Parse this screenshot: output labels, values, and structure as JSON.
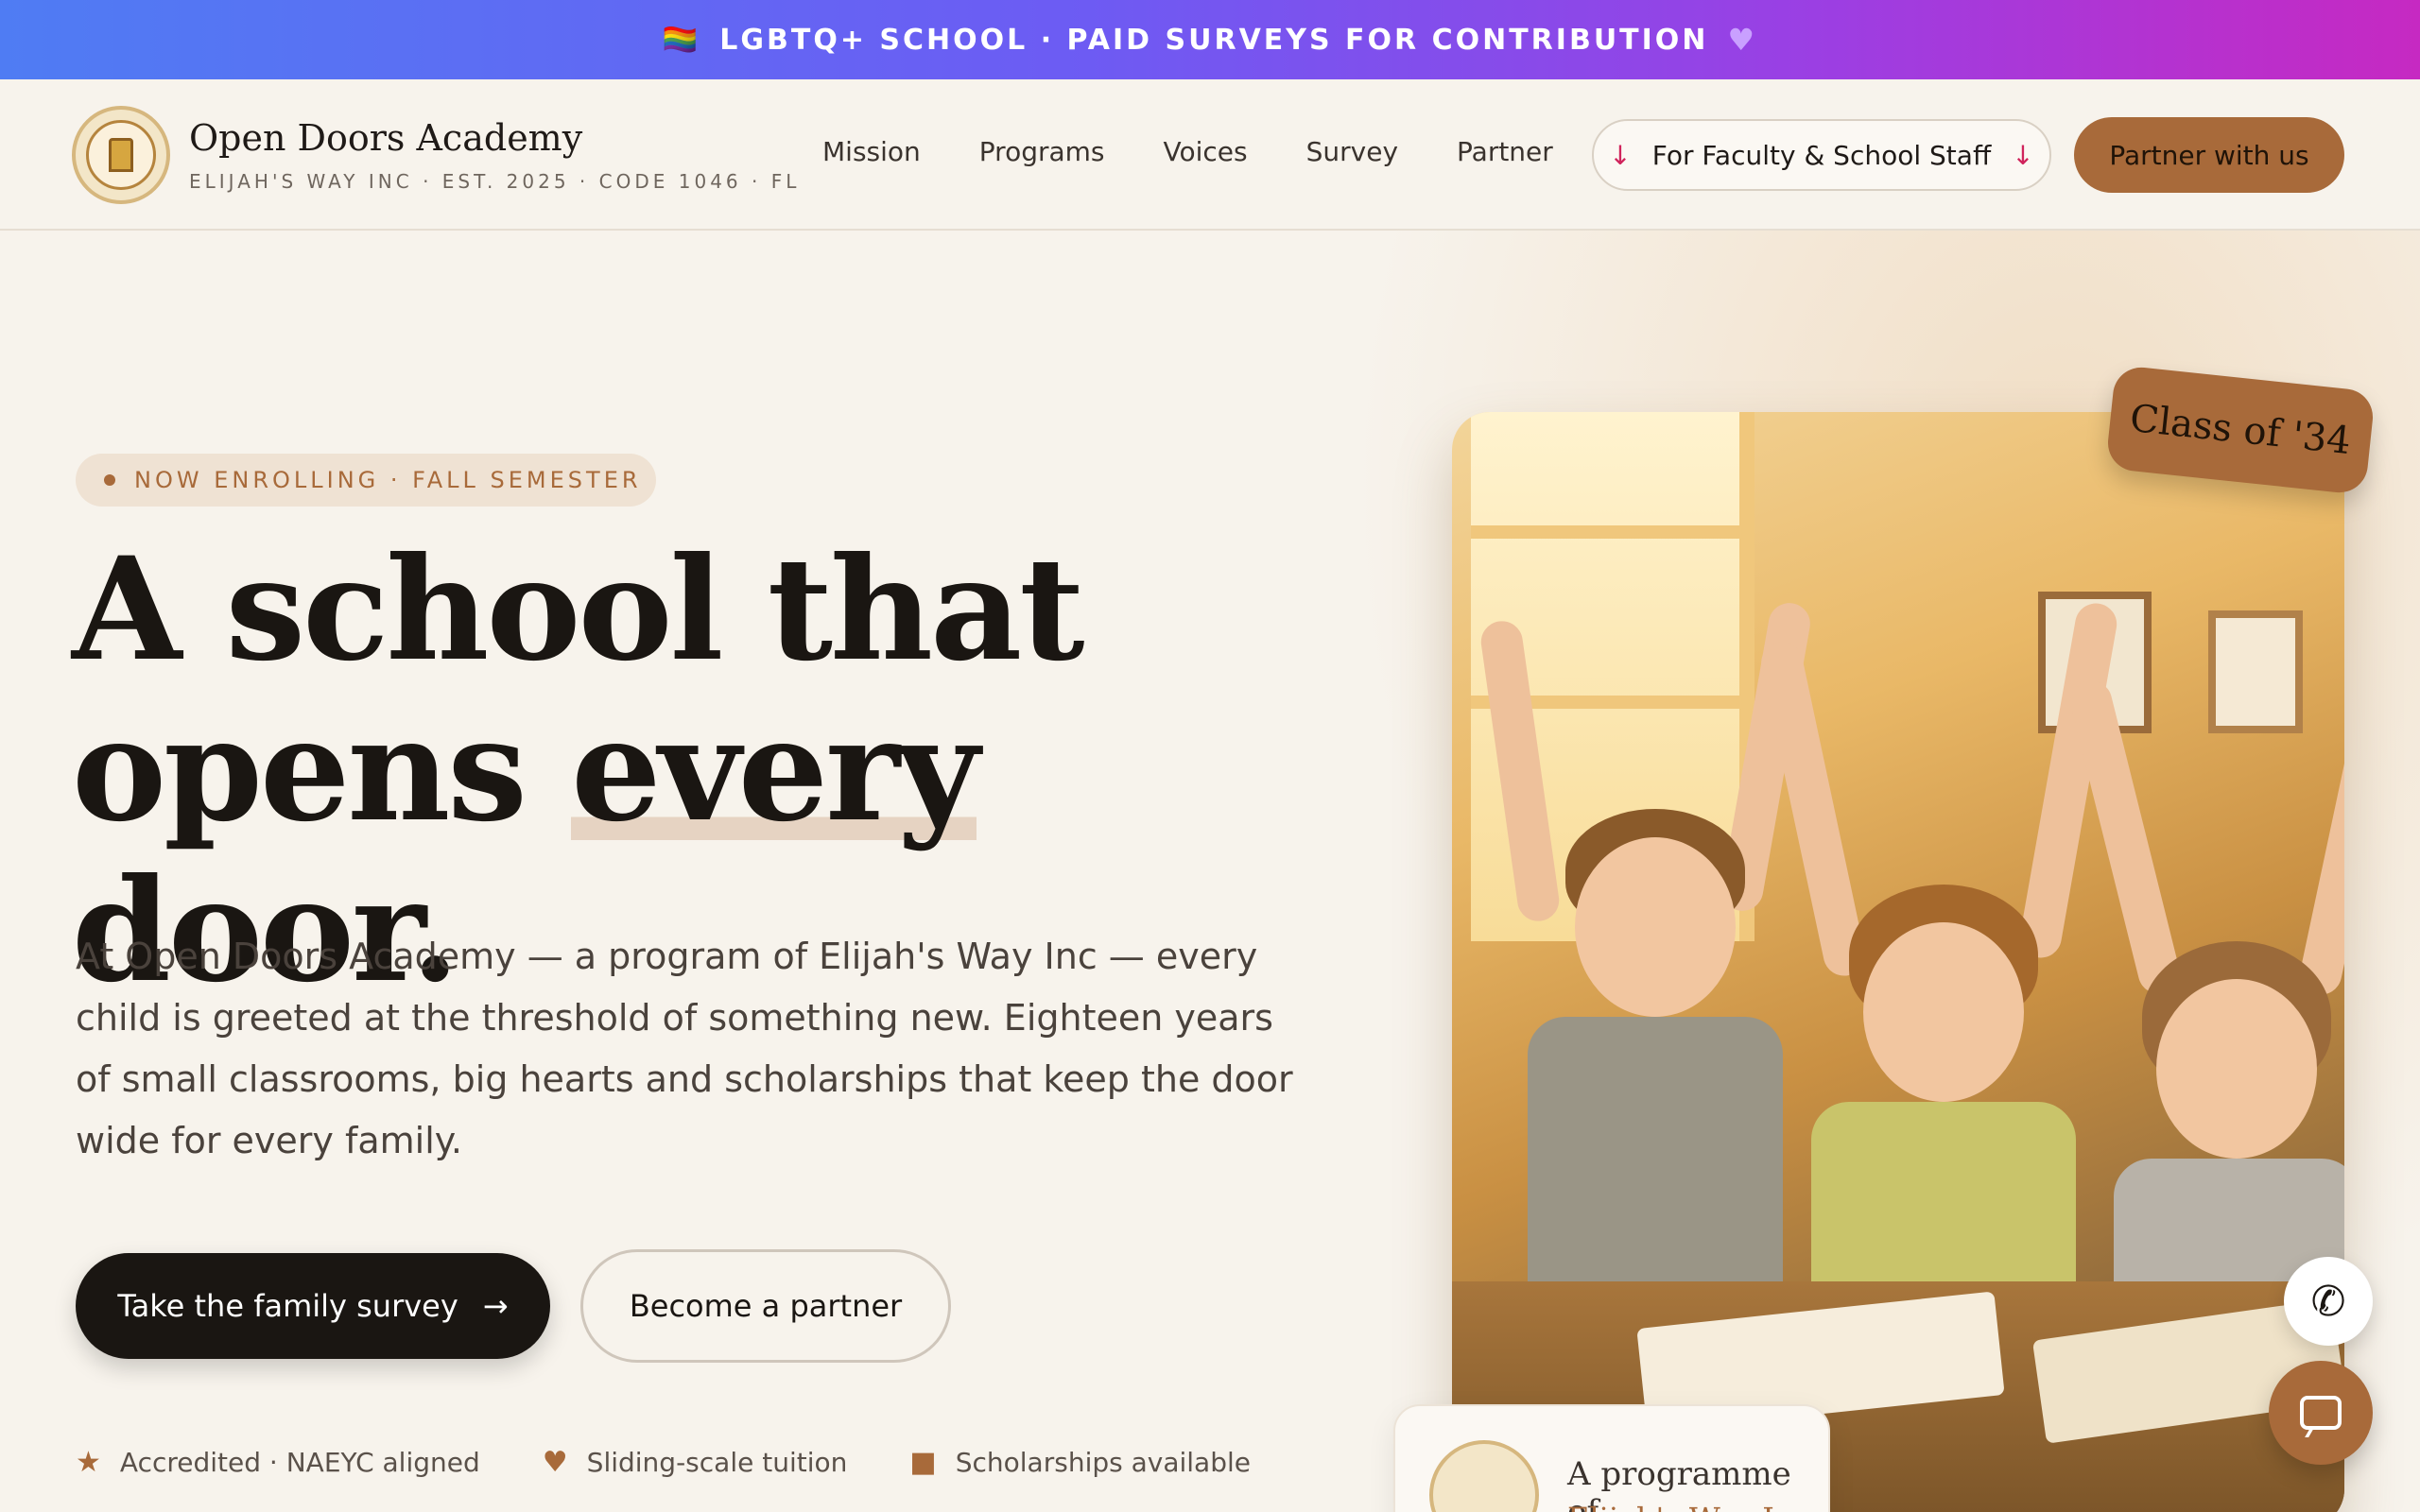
{
  "banner": {
    "flag_icon": "rainbow-flag-icon",
    "text": "LGBTQ+ SCHOOL · PAID SURVEYS FOR CONTRIBUTION",
    "heart_icon": "purple-heart-icon"
  },
  "brand": {
    "name": "Open Doors Academy",
    "subtitle": "ELIJAH'S WAY INC · EST. 2025 · CODE 1046 · FL"
  },
  "nav": {
    "items": [
      {
        "label": "Mission"
      },
      {
        "label": "Programs"
      },
      {
        "label": "Voices"
      },
      {
        "label": "Survey"
      },
      {
        "label": "Partner"
      }
    ],
    "staff_label": "For Faculty & School Staff",
    "partner_label": "Partner with us"
  },
  "hero": {
    "pill": "NOW ENROLLING · FALL SEMESTER",
    "headline_line1": "A school that",
    "headline_pre": "opens ",
    "headline_underlined": "every",
    "headline_post": " door.",
    "lead": "At Open Doors Academy — a program of Elijah's Way Inc — every child is greeted at the threshold of something new. Eighteen years of small classrooms, big hearts and scholarships that keep the door wide for every family.",
    "cta_primary": "Take the family survey",
    "cta_secondary": "Become a partner",
    "features": [
      {
        "icon": "star-icon",
        "label": "Accredited · NAEYC aligned"
      },
      {
        "icon": "heart-icon",
        "label": "Sliding-scale tuition"
      },
      {
        "icon": "box-icon",
        "label": "Scholarships available"
      }
    ]
  },
  "photo": {
    "tag": "Class of '34",
    "program_line1": "A programme of",
    "program_line2": "Elijah's Way Inc"
  },
  "colors": {
    "accent": "#a86a3a",
    "dark": "#1a1612",
    "background": "#f7f3ec",
    "banner_start": "#4f7cf3",
    "banner_end": "#c629c2"
  }
}
